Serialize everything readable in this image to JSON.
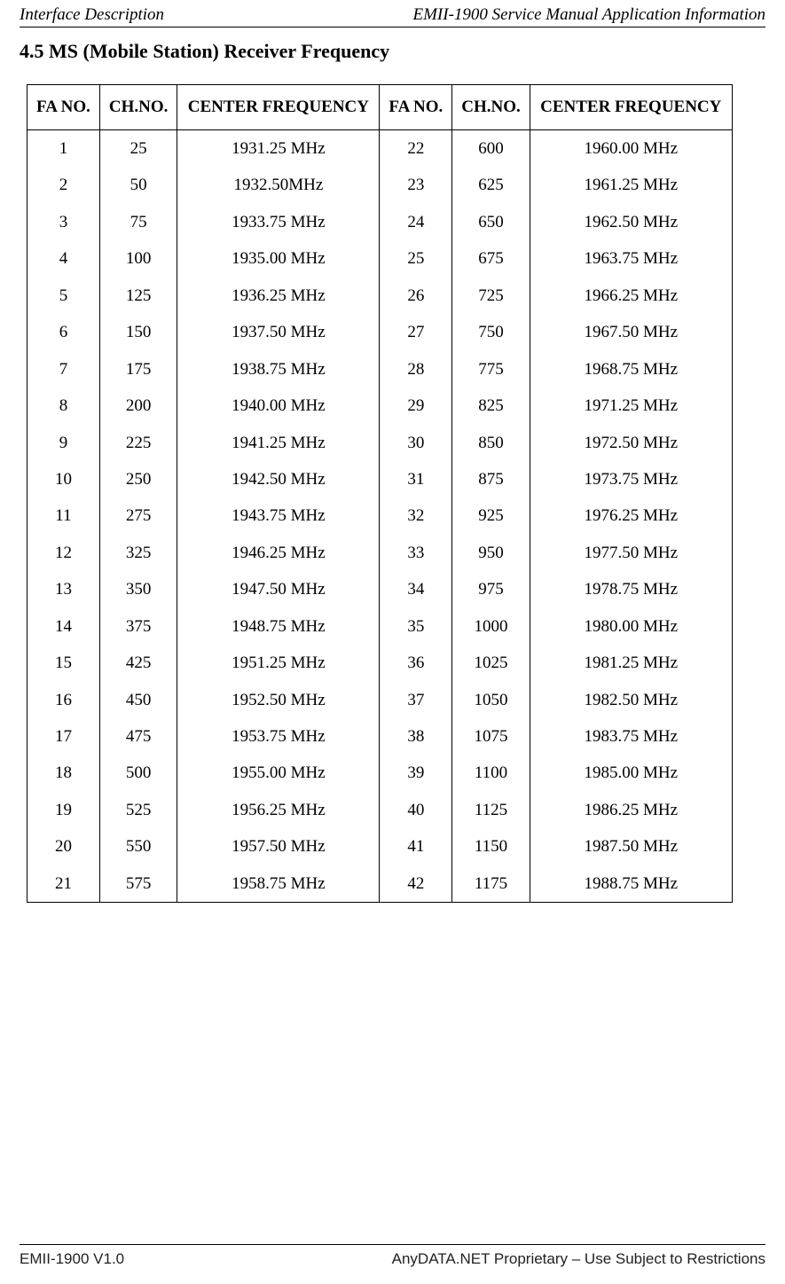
{
  "header": {
    "left": "Interface Description",
    "right": "EMII-1900 Service Manual Application Information"
  },
  "section_title": "4.5 MS (Mobile Station) Receiver Frequency",
  "table": {
    "columns": {
      "fa1": "FA NO.",
      "ch1": "CH.NO.",
      "cf1": "CENTER FREQUENCY",
      "fa2": "FA NO.",
      "ch2": "CH.NO.",
      "cf2": "CENTER FREQUENCY"
    },
    "rows": [
      {
        "fa1": "1",
        "ch1": "25",
        "cf1": "1931.25 MHz",
        "fa2": "22",
        "ch2": "600",
        "cf2": "1960.00 MHz"
      },
      {
        "fa1": "2",
        "ch1": "50",
        "cf1": "1932.50MHz",
        "fa2": "23",
        "ch2": "625",
        "cf2": "1961.25 MHz"
      },
      {
        "fa1": "3",
        "ch1": "75",
        "cf1": "1933.75 MHz",
        "fa2": "24",
        "ch2": "650",
        "cf2": "1962.50 MHz"
      },
      {
        "fa1": "4",
        "ch1": "100",
        "cf1": "1935.00 MHz",
        "fa2": "25",
        "ch2": "675",
        "cf2": "1963.75 MHz"
      },
      {
        "fa1": "5",
        "ch1": "125",
        "cf1": "1936.25 MHz",
        "fa2": "26",
        "ch2": "725",
        "cf2": "1966.25 MHz"
      },
      {
        "fa1": "6",
        "ch1": "150",
        "cf1": "1937.50 MHz",
        "fa2": "27",
        "ch2": "750",
        "cf2": "1967.50 MHz"
      },
      {
        "fa1": "7",
        "ch1": "175",
        "cf1": "1938.75 MHz",
        "fa2": "28",
        "ch2": "775",
        "cf2": "1968.75 MHz"
      },
      {
        "fa1": "8",
        "ch1": "200",
        "cf1": "1940.00 MHz",
        "fa2": "29",
        "ch2": "825",
        "cf2": "1971.25 MHz"
      },
      {
        "fa1": "9",
        "ch1": "225",
        "cf1": "1941.25 MHz",
        "fa2": "30",
        "ch2": "850",
        "cf2": "1972.50 MHz"
      },
      {
        "fa1": "10",
        "ch1": "250",
        "cf1": "1942.50 MHz",
        "fa2": "31",
        "ch2": "875",
        "cf2": "1973.75 MHz"
      },
      {
        "fa1": "11",
        "ch1": "275",
        "cf1": "1943.75 MHz",
        "fa2": "32",
        "ch2": "925",
        "cf2": "1976.25 MHz"
      },
      {
        "fa1": "12",
        "ch1": "325",
        "cf1": "1946.25 MHz",
        "fa2": "33",
        "ch2": "950",
        "cf2": "1977.50 MHz"
      },
      {
        "fa1": "13",
        "ch1": "350",
        "cf1": "1947.50 MHz",
        "fa2": "34",
        "ch2": "975",
        "cf2": "1978.75 MHz"
      },
      {
        "fa1": "14",
        "ch1": "375",
        "cf1": "1948.75 MHz",
        "fa2": "35",
        "ch2": "1000",
        "cf2": "1980.00 MHz"
      },
      {
        "fa1": "15",
        "ch1": "425",
        "cf1": "1951.25 MHz",
        "fa2": "36",
        "ch2": "1025",
        "cf2": "1981.25 MHz"
      },
      {
        "fa1": "16",
        "ch1": "450",
        "cf1": "1952.50 MHz",
        "fa2": "37",
        "ch2": "1050",
        "cf2": "1982.50 MHz"
      },
      {
        "fa1": "17",
        "ch1": "475",
        "cf1": "1953.75 MHz",
        "fa2": "38",
        "ch2": "1075",
        "cf2": "1983.75 MHz"
      },
      {
        "fa1": "18",
        "ch1": "500",
        "cf1": "1955.00 MHz",
        "fa2": "39",
        "ch2": "1100",
        "cf2": "1985.00 MHz"
      },
      {
        "fa1": "19",
        "ch1": "525",
        "cf1": "1956.25 MHz",
        "fa2": "40",
        "ch2": "1125",
        "cf2": "1986.25 MHz"
      },
      {
        "fa1": "20",
        "ch1": "550",
        "cf1": "1957.50 MHz",
        "fa2": "41",
        "ch2": "1150",
        "cf2": "1987.50 MHz"
      },
      {
        "fa1": "21",
        "ch1": "575",
        "cf1": "1958.75 MHz",
        "fa2": "42",
        "ch2": "1175",
        "cf2": "1988.75 MHz"
      }
    ]
  },
  "footer": {
    "left": "EMII-1900 V1.0",
    "right": "AnyDATA.NET Proprietary – Use Subject to Restrictions"
  }
}
